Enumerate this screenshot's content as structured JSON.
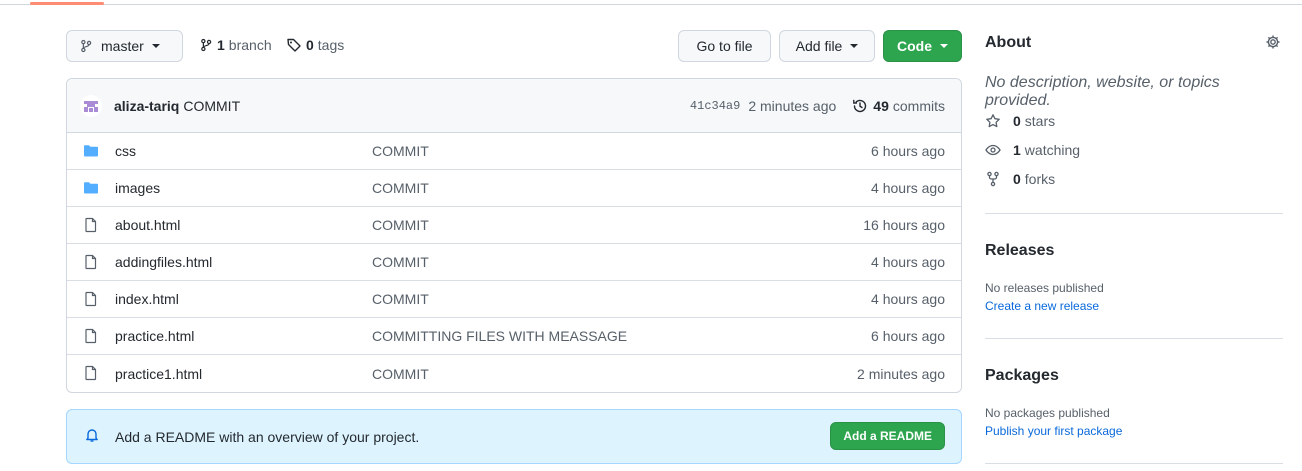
{
  "toolbar": {
    "branch_name": "master",
    "branches_count": "1",
    "branches_label": "branch",
    "tags_count": "0",
    "tags_label": "tags",
    "goto_label": "Go to file",
    "addfile_label": "Add file",
    "code_label": "Code"
  },
  "commit": {
    "author": "aliza-tariq",
    "message": "COMMIT",
    "sha": "41c34a9",
    "time": "2 minutes ago",
    "count": "49",
    "count_label": "commits"
  },
  "files": [
    {
      "name": "css",
      "type": "folder",
      "message": "COMMIT",
      "time": "6 hours ago"
    },
    {
      "name": "images",
      "type": "folder",
      "message": "COMMIT",
      "time": "4 hours ago"
    },
    {
      "name": "about.html",
      "type": "file",
      "message": "COMMIT",
      "time": "16 hours ago"
    },
    {
      "name": "addingfiles.html",
      "type": "file",
      "message": "COMMIT",
      "time": "4 hours ago"
    },
    {
      "name": "index.html",
      "type": "file",
      "message": "COMMIT",
      "time": "4 hours ago"
    },
    {
      "name": "practice.html",
      "type": "file",
      "message": "COMMITTING FILES WITH MEASSAGE",
      "time": "6 hours ago"
    },
    {
      "name": "practice1.html",
      "type": "file",
      "message": "COMMIT",
      "time": "2 minutes ago"
    }
  ],
  "readme": {
    "text": "Add a README with an overview of your project.",
    "button": "Add a README"
  },
  "sidebar": {
    "about_title": "About",
    "description": "No description, website, or topics provided.",
    "stars_count": "0",
    "stars_label": "stars",
    "watching_count": "1",
    "watching_label": "watching",
    "forks_count": "0",
    "forks_label": "forks",
    "releases_title": "Releases",
    "releases_text": "No releases published",
    "releases_link": "Create a new release",
    "packages_title": "Packages",
    "packages_text": "No packages published",
    "packages_link": "Publish your first package"
  },
  "colors": {
    "primary_green": "#2da44e",
    "link_blue": "#0969da",
    "folder_blue": "#54aeff",
    "readme_bg": "#ddf4ff"
  }
}
